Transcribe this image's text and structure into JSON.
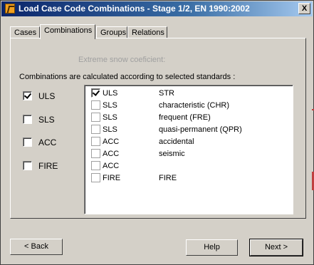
{
  "window": {
    "title": "Load Case Code Combinations - Stage 1/2, EN 1990:2002",
    "close_glyph": "X"
  },
  "tabs": [
    {
      "label": "Cases",
      "active": false
    },
    {
      "label": "Combinations",
      "active": true
    },
    {
      "label": "Groups",
      "active": false
    },
    {
      "label": "Relations",
      "active": false
    }
  ],
  "panel": {
    "snow_label": "Extreme snow coeficient:",
    "combos_label": "Combinations are calculated according to selected standards :",
    "standards": [
      {
        "label": "ULS",
        "checked": true
      },
      {
        "label": "SLS",
        "checked": false
      },
      {
        "label": "ACC",
        "checked": false
      },
      {
        "label": "FIRE",
        "checked": false
      }
    ],
    "list": [
      {
        "name": "ULS",
        "desc": "STR",
        "checked": true
      },
      {
        "name": "SLS",
        "desc": "characteristic (CHR)",
        "checked": false
      },
      {
        "name": "SLS",
        "desc": "frequent (FRE)",
        "checked": false
      },
      {
        "name": "SLS",
        "desc": "quasi-permanent (QPR)",
        "checked": false
      },
      {
        "name": "ACC",
        "desc": "accidental",
        "checked": false
      },
      {
        "name": "ACC",
        "desc": "seismic",
        "checked": false
      },
      {
        "name": "ACC",
        "desc": "",
        "checked": false
      },
      {
        "name": "FIRE",
        "desc": "FIRE",
        "checked": false
      }
    ]
  },
  "buttons": {
    "back": "< Back",
    "help": "Help",
    "next": "Next >"
  }
}
